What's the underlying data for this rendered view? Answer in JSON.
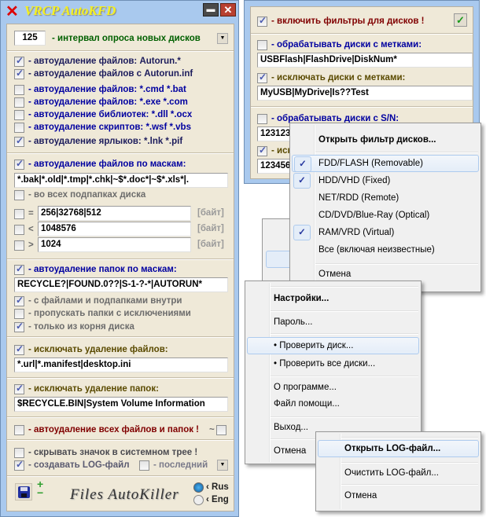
{
  "main_window": {
    "title": "VRCP  AutoKFD",
    "interval": {
      "value": "125",
      "label": "- интервал опроса новых дисков"
    },
    "file_options": [
      {
        "label": "- автоудаление файлов:  Autorun.*",
        "checked": true
      },
      {
        "label": "- автоудаление файлов с Autorun.inf",
        "checked": true
      },
      {
        "label": "- автоудаление файлов:  *.cmd  *.bat",
        "checked": false
      },
      {
        "label": "- автоудаление файлов:  *.exe  *.com",
        "checked": false
      },
      {
        "label": "- автоудаление библиотек:  *.dll  *.ocx",
        "checked": false
      },
      {
        "label": "- автоудаление скриптов:  *.wsf  *.vbs",
        "checked": false
      },
      {
        "label": "- автоудаление ярлыков:  *.lnk  *.pif",
        "checked": true
      }
    ],
    "file_masks": {
      "label": "- автоудаление файлов по маскам:",
      "checked": true,
      "value": "*.bak|*.old|*.tmp|*.chk|~$*.doc*|~$*.xls*|.",
      "subfolders_label": "- во всех подпапках диска",
      "subfolders_checked": false
    },
    "size_filters": [
      {
        "op": "=",
        "value": "256|32768|512",
        "unit": "[байт]",
        "checked": false
      },
      {
        "op": "<",
        "value": "1048576",
        "unit": "[байт]",
        "checked": false
      },
      {
        "op": ">",
        "value": "1024",
        "unit": "[байт]",
        "checked": false
      }
    ],
    "folder_masks": {
      "label": "- автоудаление папок по маскам:",
      "checked": true,
      "value": "RECYCLE?|FOUND.0??|S-1-?-*|AUTORUN*",
      "options": [
        {
          "label": "- с файлами и подпапками внутри",
          "checked": true
        },
        {
          "label": "- пропускать папки с исключениями",
          "checked": false
        },
        {
          "label": "- только из корня диска",
          "checked": true
        }
      ]
    },
    "exclude_files": {
      "label": "- исключать удаление файлов:",
      "checked": true,
      "value": "*.url|*.manifest|desktop.ini"
    },
    "exclude_folders": {
      "label": "- исключать удаление папок:",
      "checked": true,
      "value": "$RECYCLE.BIN|System Volume Information"
    },
    "delete_all": {
      "label": "- автоудаление всех файлов и папок !",
      "checked": false,
      "tilde": "~",
      "tilde_checked": false
    },
    "hide_tray": {
      "label": "- скрывать значок в системном трее !",
      "checked": false
    },
    "log": {
      "label": "- создавать LOG-файл",
      "checked": true,
      "last_label": "- последний",
      "last_checked": false
    },
    "logo_text": "Files AutoKiller",
    "languages": [
      {
        "label": "Rus",
        "selected": true
      },
      {
        "label": "Eng",
        "selected": false
      }
    ]
  },
  "filter_window": {
    "enable": {
      "label": "- включить фильтры для дисков !",
      "checked": true
    },
    "process_labels": {
      "label": "- обрабатывать диски с метками:",
      "checked": false,
      "value": "USBFlash|FlashDrive|DiskNum*"
    },
    "exclude_labels": {
      "label": "- исключать диски с метками:",
      "checked": true,
      "value": "MyUSB|MyDrive|Is??Test"
    },
    "process_sn": {
      "label": "- обрабатывать диски с S/N:",
      "checked": false,
      "value": "123123"
    },
    "exclude_sn": {
      "label": "- иск",
      "checked": true,
      "value": "123456"
    }
  },
  "filter_menu": {
    "header": "Открыть фильтр дисков...",
    "items": [
      {
        "label": "FDD/FLASH  (Removable)",
        "checked": true
      },
      {
        "label": "HDD/VHD  (Fixed)",
        "checked": true
      },
      {
        "label": "NET/RDD  (Remote)",
        "checked": false
      },
      {
        "label": "CD/DVD/Blue-Ray  (Optical)",
        "checked": false
      },
      {
        "label": "RAM/VRD  (Virtual)",
        "checked": true
      },
      {
        "label": "Все  (включая неизвестные)",
        "checked": false
      }
    ],
    "cancel": "Отмена"
  },
  "tray_menu": {
    "settings": "Настройки...",
    "password": "Пароль...",
    "check_disk": "• Проверить диск...",
    "check_all": "• Проверить все диски...",
    "about": "О программе...",
    "help": "Файл помощи...",
    "exit": "Выход...",
    "cancel": "Отмена"
  },
  "log_menu": {
    "open": "Открыть LOG-файл...",
    "clear": "Очистить LOG-файл...",
    "cancel": "Отмена"
  }
}
